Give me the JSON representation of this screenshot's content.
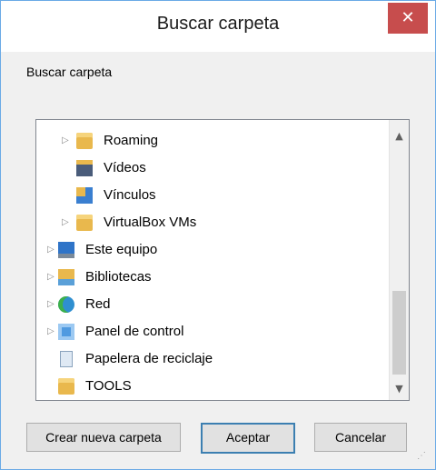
{
  "window": {
    "title": "Buscar carpeta",
    "close_glyph": "✕"
  },
  "description": "Buscar carpeta",
  "tree": {
    "items": [
      {
        "label": "Roaming",
        "icon": "folder-icon",
        "expandable": true
      },
      {
        "label": "Vídeos",
        "icon": "videos-folder-icon",
        "expandable": false
      },
      {
        "label": "Vínculos",
        "icon": "links-folder-icon",
        "expandable": false
      },
      {
        "label": "VirtualBox VMs",
        "icon": "folder-icon",
        "expandable": true
      },
      {
        "label": "Este equipo",
        "icon": "computer-icon",
        "expandable": true
      },
      {
        "label": "Bibliotecas",
        "icon": "libraries-icon",
        "expandable": true
      },
      {
        "label": "Red",
        "icon": "network-icon",
        "expandable": true
      },
      {
        "label": "Panel de control",
        "icon": "control-panel-icon",
        "expandable": true
      },
      {
        "label": "Papelera de reciclaje",
        "icon": "recycle-bin-icon",
        "expandable": false
      },
      {
        "label": "TOOLS",
        "icon": "folder-icon",
        "expandable": false
      }
    ]
  },
  "buttons": {
    "new_folder": "Crear nueva carpeta",
    "ok": "Aceptar",
    "cancel": "Cancelar"
  }
}
